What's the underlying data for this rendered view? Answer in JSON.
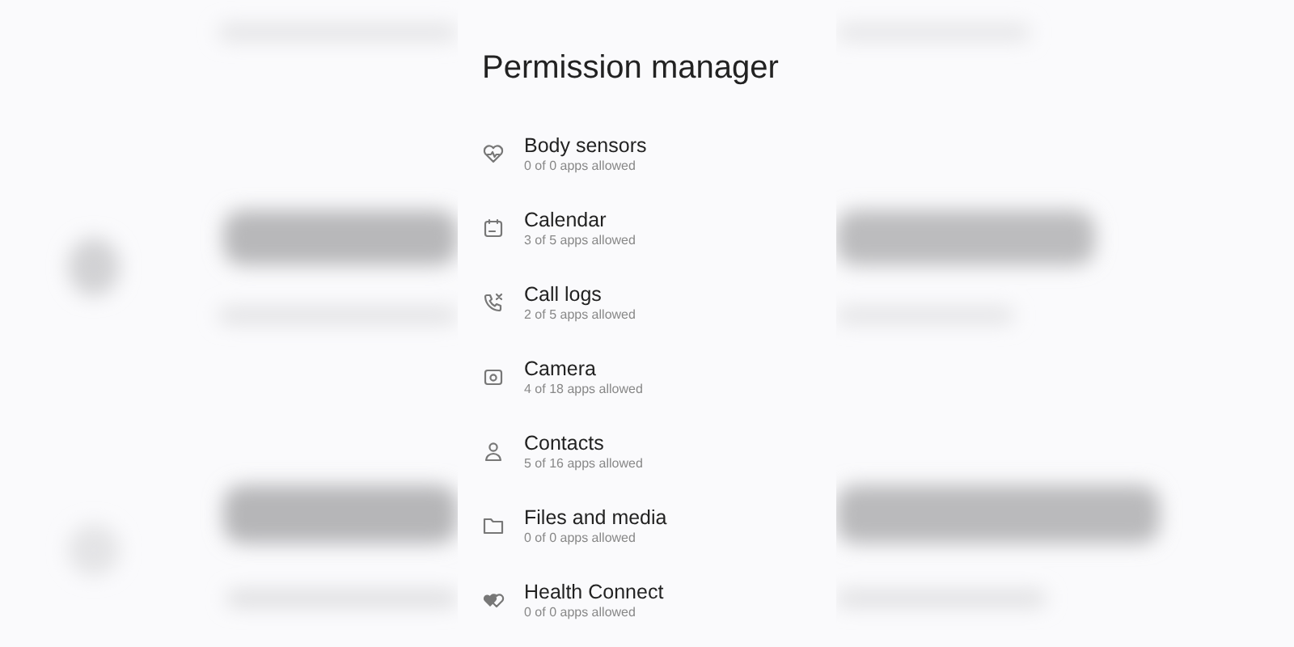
{
  "title": "Permission manager",
  "permissions": [
    {
      "name": "Body sensors",
      "summary": "0 of 0 apps allowed"
    },
    {
      "name": "Calendar",
      "summary": "3 of 5 apps allowed"
    },
    {
      "name": "Call logs",
      "summary": "2 of 5 apps allowed"
    },
    {
      "name": "Camera",
      "summary": "4 of 18 apps allowed"
    },
    {
      "name": "Contacts",
      "summary": "5 of 16 apps allowed"
    },
    {
      "name": "Files and media",
      "summary": "0 of 0 apps allowed"
    },
    {
      "name": "Health Connect",
      "summary": "0 of 0 apps allowed"
    }
  ]
}
